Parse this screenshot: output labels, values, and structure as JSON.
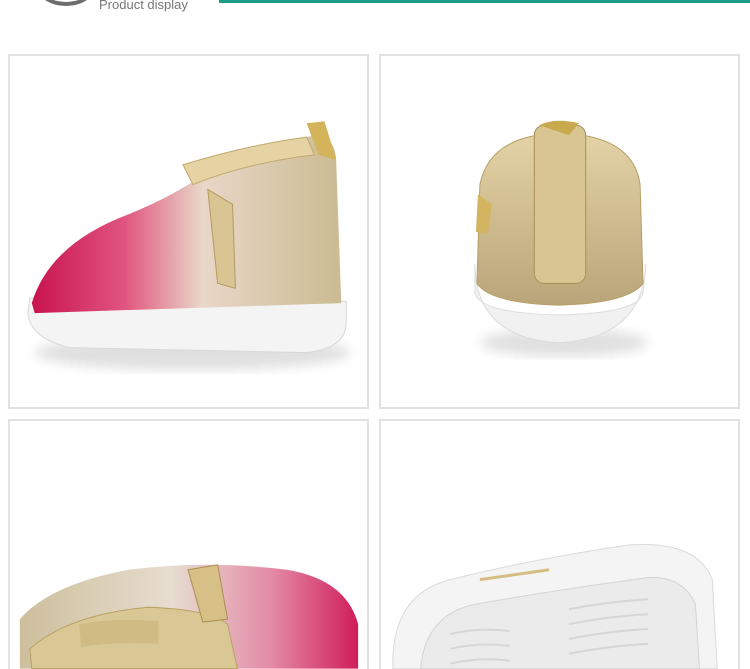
{
  "header": {
    "subtitle": "Product display",
    "accent_color": "#1d9b86"
  },
  "gallery": {
    "views": [
      {
        "view": "side",
        "glyph": "side-view-shoe"
      },
      {
        "view": "back",
        "glyph": "back-view-shoe"
      },
      {
        "view": "top",
        "glyph": "top-view-shoe"
      },
      {
        "view": "sole",
        "glyph": "sole-view-shoe"
      }
    ],
    "colors": {
      "pink": "#d4205e",
      "gold": "#cdb889",
      "sole": "#f3f3f3",
      "leather": "#d9c79a"
    }
  }
}
